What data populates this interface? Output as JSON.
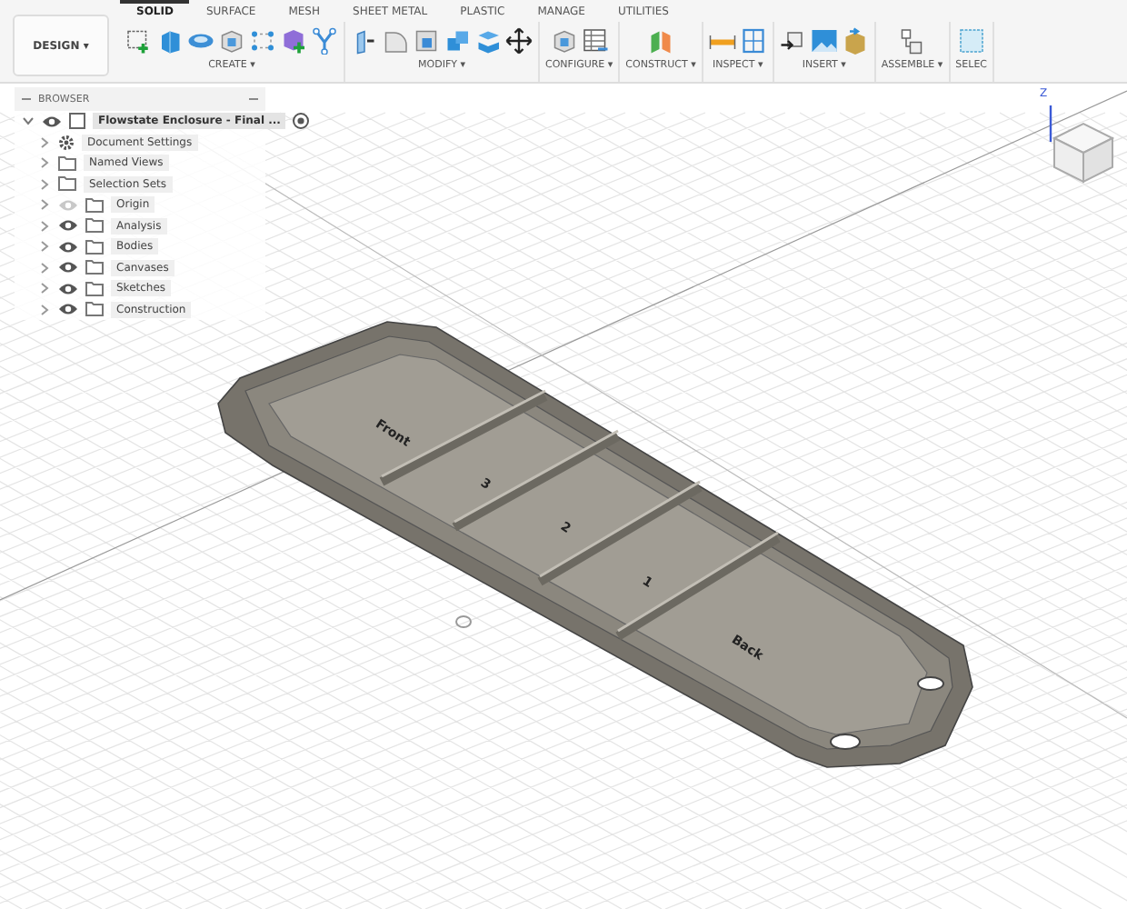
{
  "mode_button": {
    "label": "DESIGN",
    "caret": "▾"
  },
  "tabs": [
    {
      "label": "SOLID",
      "selected": true
    },
    {
      "label": "SURFACE",
      "selected": false
    },
    {
      "label": "MESH",
      "selected": false
    },
    {
      "label": "SHEET METAL",
      "selected": false
    },
    {
      "label": "PLASTIC",
      "selected": false
    },
    {
      "label": "MANAGE",
      "selected": false
    },
    {
      "label": "UTILITIES",
      "selected": false
    }
  ],
  "tool_groups": [
    {
      "label": "CREATE ▾",
      "tools": [
        {
          "kind": "sketch"
        },
        {
          "kind": "block"
        },
        {
          "kind": "revolve"
        },
        {
          "kind": "cube"
        },
        {
          "kind": "dots"
        },
        {
          "kind": "form"
        },
        {
          "kind": "branch"
        }
      ]
    },
    {
      "label": "MODIFY ▾",
      "tools": [
        {
          "kind": "press"
        },
        {
          "kind": "fillet"
        },
        {
          "kind": "shell"
        },
        {
          "kind": "combine"
        },
        {
          "kind": "stack"
        },
        {
          "kind": "move"
        }
      ]
    },
    {
      "label": "CONFIGURE ▾",
      "tools": [
        {
          "kind": "cube"
        },
        {
          "kind": "table"
        }
      ]
    },
    {
      "label": "CONSTRUCT ▾",
      "tools": [
        {
          "kind": "plane"
        }
      ]
    },
    {
      "label": "INSPECT ▾",
      "tools": [
        {
          "kind": "ruler"
        },
        {
          "kind": "section"
        }
      ]
    },
    {
      "label": "INSERT ▾",
      "tools": [
        {
          "kind": "insert"
        },
        {
          "kind": "picture"
        },
        {
          "kind": "crate"
        }
      ]
    },
    {
      "label": "ASSEMBLE ▾",
      "tools": [
        {
          "kind": "joint"
        }
      ]
    },
    {
      "label": "SELEC",
      "tools": [
        {
          "kind": "select"
        }
      ]
    }
  ],
  "browser": {
    "title": "BROWSER",
    "root": {
      "label": "Flowstate Enclosure - Final ...",
      "visible": true
    },
    "items": [
      {
        "label": "Document Settings",
        "kind": "settings"
      },
      {
        "label": "Named Views",
        "kind": "folder"
      },
      {
        "label": "Selection Sets",
        "kind": "folder"
      },
      {
        "label": "Origin",
        "kind": "layer",
        "visible": false
      },
      {
        "label": "Analysis",
        "kind": "layer",
        "visible": true
      },
      {
        "label": "Bodies",
        "kind": "layer",
        "visible": true
      },
      {
        "label": "Canvases",
        "kind": "layer",
        "visible": true
      },
      {
        "label": "Sketches",
        "kind": "layer",
        "visible": true
      },
      {
        "label": "Construction",
        "kind": "layer",
        "visible": true
      }
    ]
  },
  "model_labels": [
    "Front",
    "3",
    "2",
    "1",
    "Back"
  ],
  "view_cube": {
    "axis": "Z"
  }
}
